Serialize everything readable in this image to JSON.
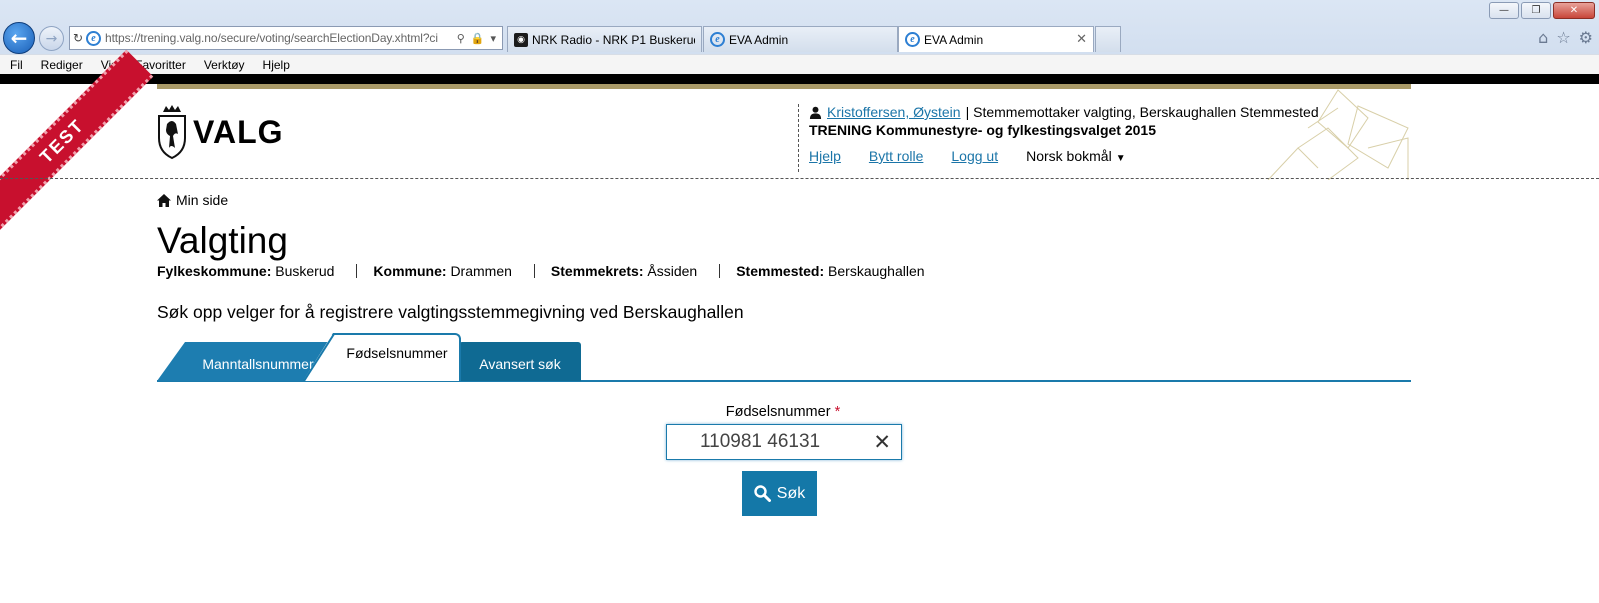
{
  "browser": {
    "address": "https://trening.valg.no/secure/voting/searchElectionDay.xhtml?ci",
    "tabs": [
      {
        "label": "NRK Radio - NRK P1 Buskerud ..."
      },
      {
        "label": "EVA Admin"
      },
      {
        "label": "EVA Admin"
      }
    ],
    "menu": [
      "Fil",
      "Rediger",
      "Vis",
      "Favoritter",
      "Verktøy",
      "Hjelp"
    ]
  },
  "ribbon": {
    "label": "TEST"
  },
  "logo": {
    "text": "VALG"
  },
  "user": {
    "name": "Kristoffersen, Øystein",
    "role": "| Stemmemottaker valgting, Berskaughallen Stemmested",
    "election": "TRENING Kommunestyre- og fylkestingsvalget 2015",
    "help": "Hjelp",
    "switch_role": "Bytt rolle",
    "logout": "Logg ut",
    "language": "Norsk bokmål"
  },
  "breadcrumb": {
    "label": "Min side"
  },
  "page": {
    "title": "Valgting",
    "info": [
      {
        "key": "Fylkeskommune:",
        "value": "Buskerud"
      },
      {
        "key": "Kommune:",
        "value": "Drammen"
      },
      {
        "key": "Stemmekrets:",
        "value": "Åssiden"
      },
      {
        "key": "Stemmested:",
        "value": "Berskaughallen"
      }
    ],
    "subtitle": "Søk opp velger for å registrere valgtingsstemmegivning ved Berskaughallen"
  },
  "search_tabs": [
    {
      "label": "Manntallsnummer"
    },
    {
      "label": "Fødselsnummer"
    },
    {
      "label": "Avansert søk"
    }
  ],
  "form": {
    "label": "Fødselsnummer",
    "required_mark": "*",
    "value": "110981 46131",
    "button": "Søk"
  },
  "colors": {
    "brand_blue": "#1478a8",
    "gold": "#a99a68",
    "test_red": "#c8102e"
  }
}
